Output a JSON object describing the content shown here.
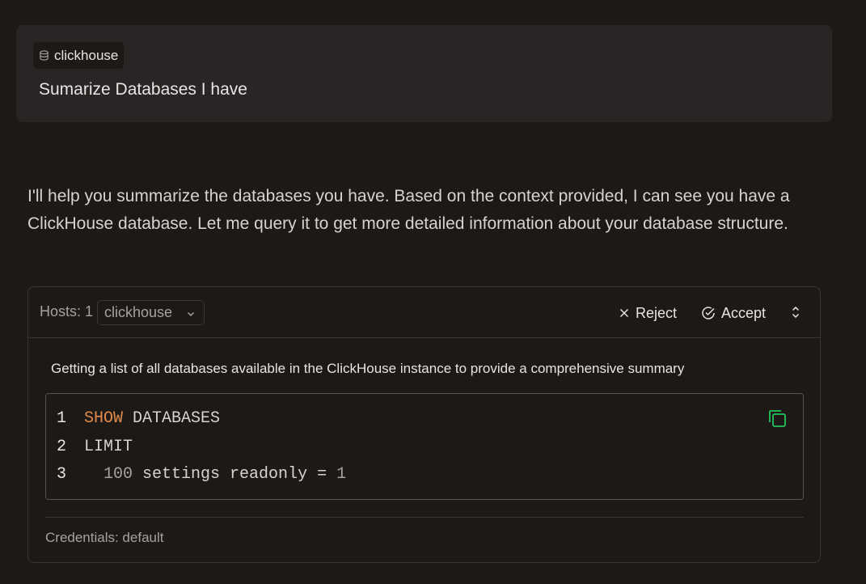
{
  "user_message": {
    "context_chip": {
      "icon": "database-icon",
      "label": "clickhouse"
    },
    "text": "Sumarize Databases I have"
  },
  "assistant": {
    "text": "I'll help you summarize the databases you have. Based on the context provided, I can see you have a ClickHouse database. Let me query it to get more detailed information about your database structure."
  },
  "tool_card": {
    "hosts_label": "Hosts: 1",
    "host_select": {
      "value": "clickhouse",
      "icon": "chevron-down-icon"
    },
    "reject_label": "Reject",
    "accept_label": "Accept",
    "description": "Getting a list of all databases available in the ClickHouse instance to provide a comprehensive summary",
    "code": {
      "line1": {
        "num": "1",
        "keyword": "SHOW",
        "rest": " DATABASES"
      },
      "line2": {
        "num": "2",
        "text": "LIMIT"
      },
      "line3": {
        "num": "3",
        "indent": "  ",
        "value": "100",
        "mid": " settings readonly = ",
        "value2": "1"
      }
    },
    "credentials": "Credentials: default"
  },
  "colors": {
    "background": "#1c1917",
    "surface": "#292524",
    "keyword": "#e08a4b",
    "copy_icon": "#22c55e"
  }
}
